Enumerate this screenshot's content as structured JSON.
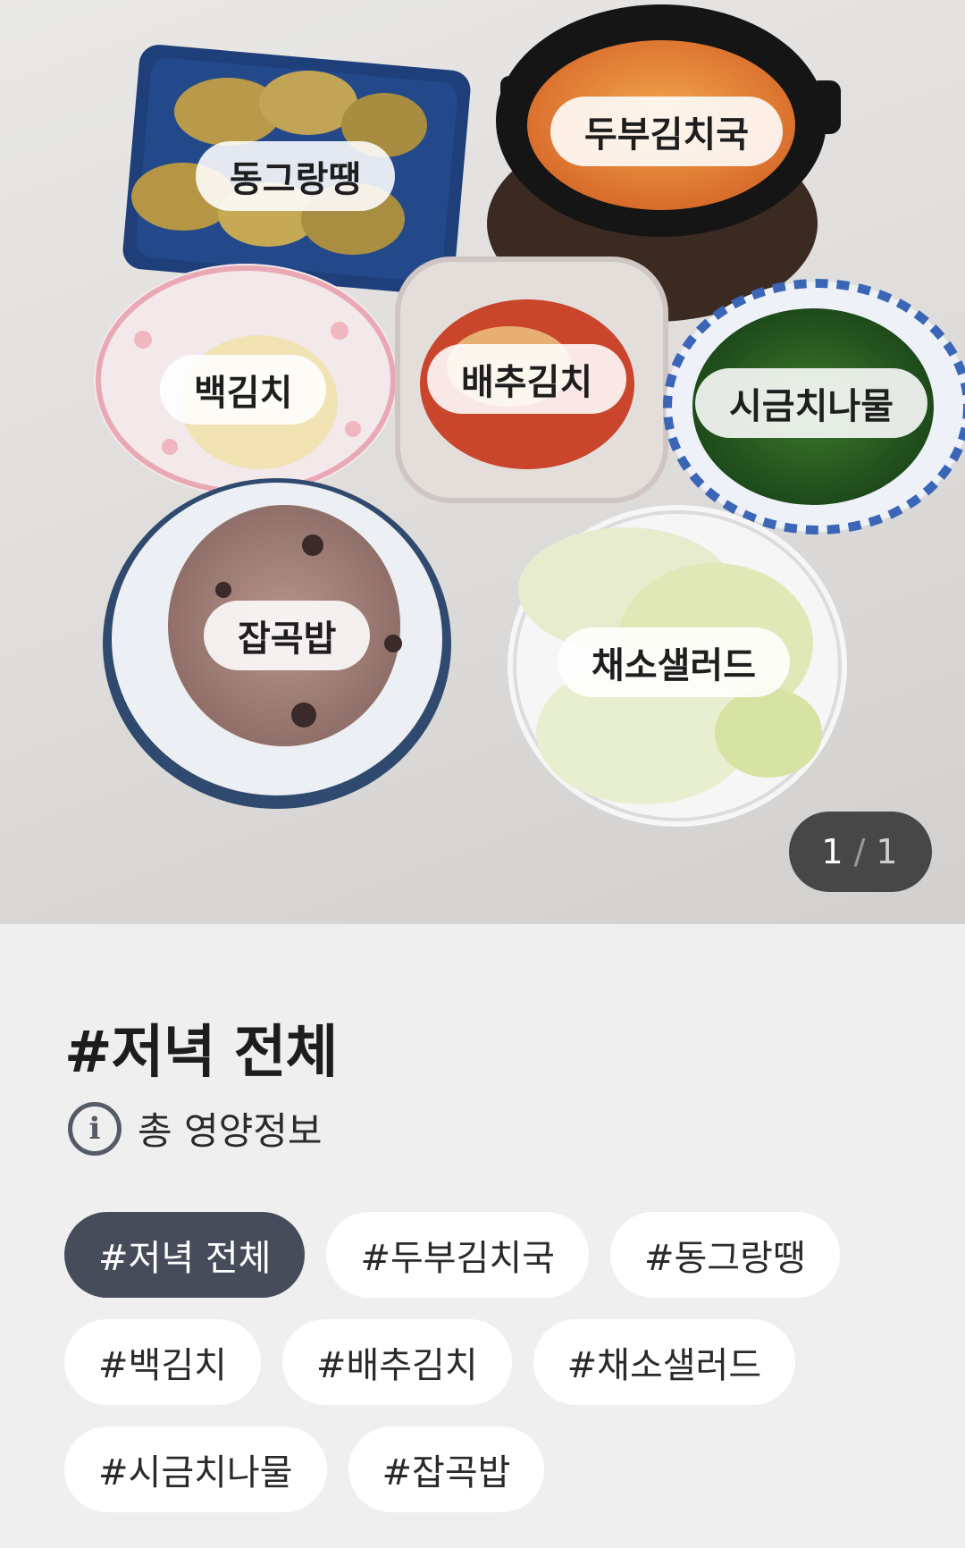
{
  "photo": {
    "labels": {
      "donggeurangttaeng": "동그랑땡",
      "dubu_kimchi_guk": "두부김치국",
      "baek_kimchi": "백김치",
      "baechu_kimchi": "배추김치",
      "sigeumchi_namul": "시금치나물",
      "japgokbap": "잡곡밥",
      "chaeso_salad": "채소샐러드"
    },
    "counter": {
      "current": "1",
      "separator": "/",
      "total": "1"
    }
  },
  "meal": {
    "title": "#저녁 전체",
    "nutrition_label": "총 영양정보",
    "info_icon": "info-circle-icon"
  },
  "tags": [
    {
      "label": "#저녁 전체",
      "active": true
    },
    {
      "label": "#두부김치국",
      "active": false
    },
    {
      "label": "#동그랑땡",
      "active": false
    },
    {
      "label": "#백김치",
      "active": false
    },
    {
      "label": "#배추김치",
      "active": false
    },
    {
      "label": "#채소샐러드",
      "active": false
    },
    {
      "label": "#시금치나물",
      "active": false
    },
    {
      "label": "#잡곡밥",
      "active": false
    }
  ],
  "colors": {
    "active_tag_bg": "#464c5a",
    "inactive_tag_bg": "#ffffff",
    "page_bg": "#efefef",
    "counter_bg": "#282828"
  }
}
